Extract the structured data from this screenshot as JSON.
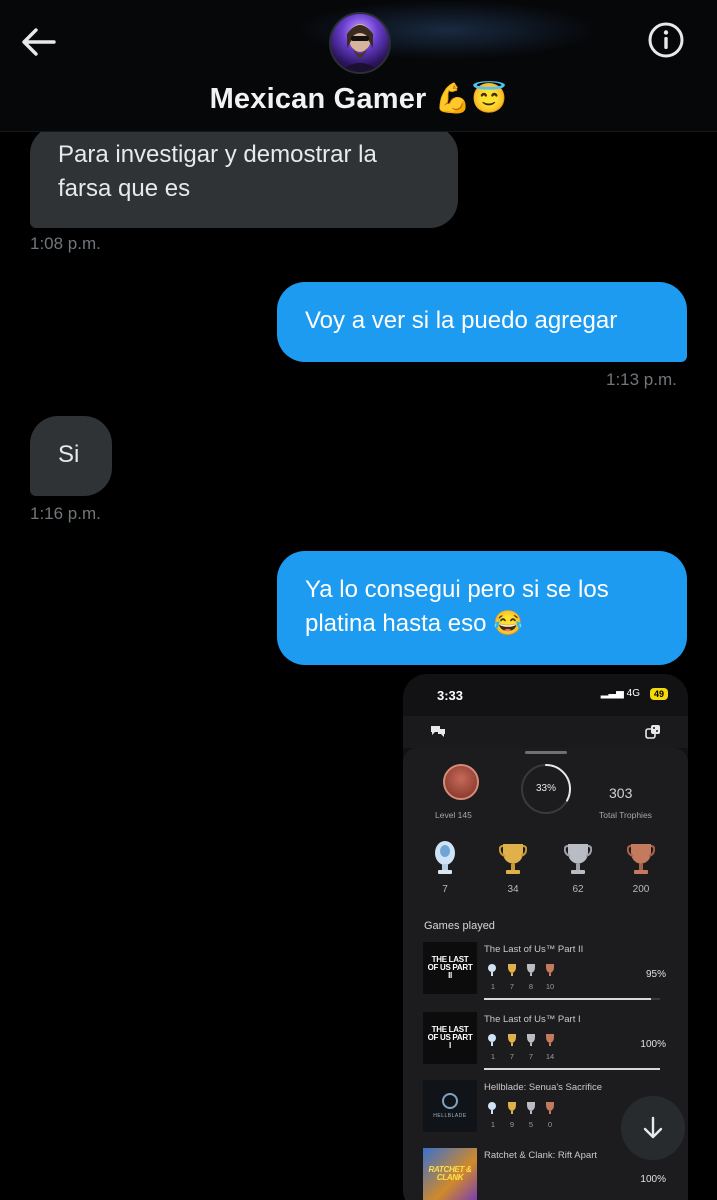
{
  "header": {
    "title": "Mexican Gamer 💪😇"
  },
  "messages": [
    {
      "type": "in",
      "text": "Para investigar y demostrar la farsa que es",
      "time": "1:08 p.m."
    },
    {
      "type": "out",
      "text": "Voy a ver si la puedo agregar",
      "time": "1:13 p.m."
    },
    {
      "type": "in",
      "text": "Si",
      "time": "1:16 p.m."
    },
    {
      "type": "out",
      "text": "Ya lo consegui pero si se los platina hasta eso 😂"
    }
  ],
  "screenshot": {
    "status_time": "3:33",
    "network": "4G",
    "battery": "49",
    "level_label": "Level 145",
    "progress": "33%",
    "progress_value": 0.33,
    "total_trophies": "303",
    "total_label": "Total Trophies",
    "trophies": [
      {
        "kind": "platinum",
        "count": "7"
      },
      {
        "kind": "gold",
        "count": "34"
      },
      {
        "kind": "silver",
        "count": "62"
      },
      {
        "kind": "bronze",
        "count": "200"
      }
    ],
    "games_played_label": "Games played",
    "games": [
      {
        "name": "The Last of Us™ Part II",
        "cover_text": "THE LAST OF US PART II",
        "counts": [
          "1",
          "7",
          "8",
          "10"
        ],
        "pct": "95%",
        "progress": 0.95
      },
      {
        "name": "The Last of Us™ Part I",
        "cover_text": "THE LAST OF US PART I",
        "counts": [
          "1",
          "7",
          "7",
          "14"
        ],
        "pct": "100%",
        "progress": 1.0
      },
      {
        "name": "Hellblade: Senua's Sacrifice",
        "cover_text": "HELLBLADE",
        "counts": [
          "1",
          "9",
          "5",
          "0"
        ],
        "pct": "",
        "progress": 0
      },
      {
        "name": "Ratchet & Clank: Rift Apart",
        "cover_text": "RATCHET & CLANK",
        "counts": [],
        "pct": "100%",
        "progress": 1.0
      }
    ]
  },
  "colors": {
    "outgoing": "#1d9bf0",
    "incoming": "#2f3336",
    "background": "#000000",
    "timestamp": "#71767b"
  }
}
